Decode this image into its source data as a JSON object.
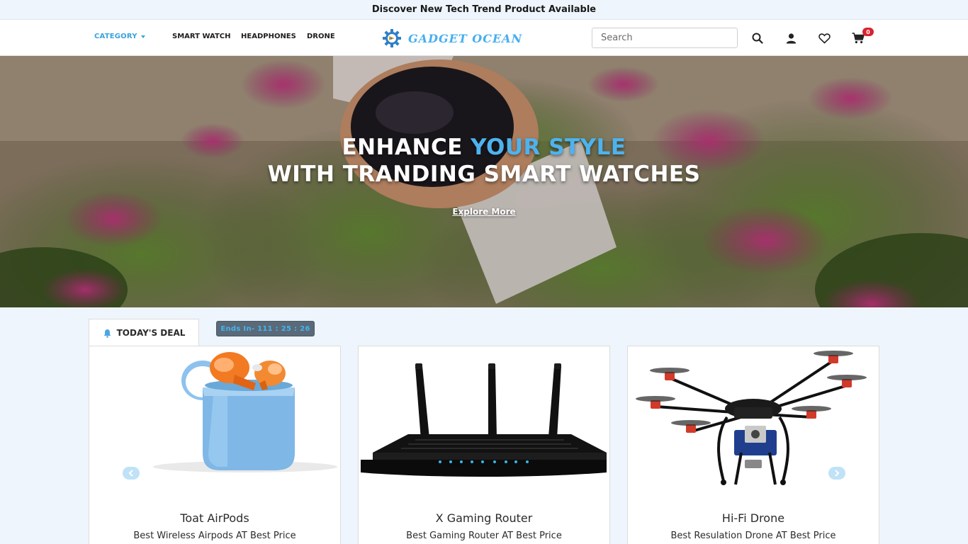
{
  "announcement": "Discover New Tech Trend Product Available",
  "nav": {
    "category_label": "CATEGORY",
    "links": [
      "SMART WATCH",
      "HEADPHONES",
      "DRONE"
    ],
    "logo_text": "GADGET OCEAN",
    "search_placeholder": "Search",
    "cart_count": "0"
  },
  "hero": {
    "line1_prefix": "ENHANCE ",
    "line1_accent": "YOUR STYLE",
    "line2": "WITH TRANDING SMART WATCHES",
    "cta": "Explore More"
  },
  "deal": {
    "tab_label": "TODAY'S DEAL",
    "countdown": "Ends In- 111 : 25 : 26"
  },
  "products": [
    {
      "title": "Toat AirPods",
      "subtitle": "Best Wireless Airpods AT Best Price"
    },
    {
      "title": "X Gaming Router",
      "subtitle": "Best Gaming Router AT Best Price"
    },
    {
      "title": "Hi-Fi Drone",
      "subtitle": "Best Resulation Drone AT Best Price"
    }
  ],
  "colors": {
    "accent": "#4db3ee",
    "badge": "#d9232e",
    "countdown_bg": "#5b6a78"
  },
  "icons": [
    "search-icon",
    "user-icon",
    "heart-icon",
    "cart-icon",
    "bell-icon",
    "chevron-left-icon",
    "chevron-right-icon",
    "gear-logo-icon"
  ]
}
